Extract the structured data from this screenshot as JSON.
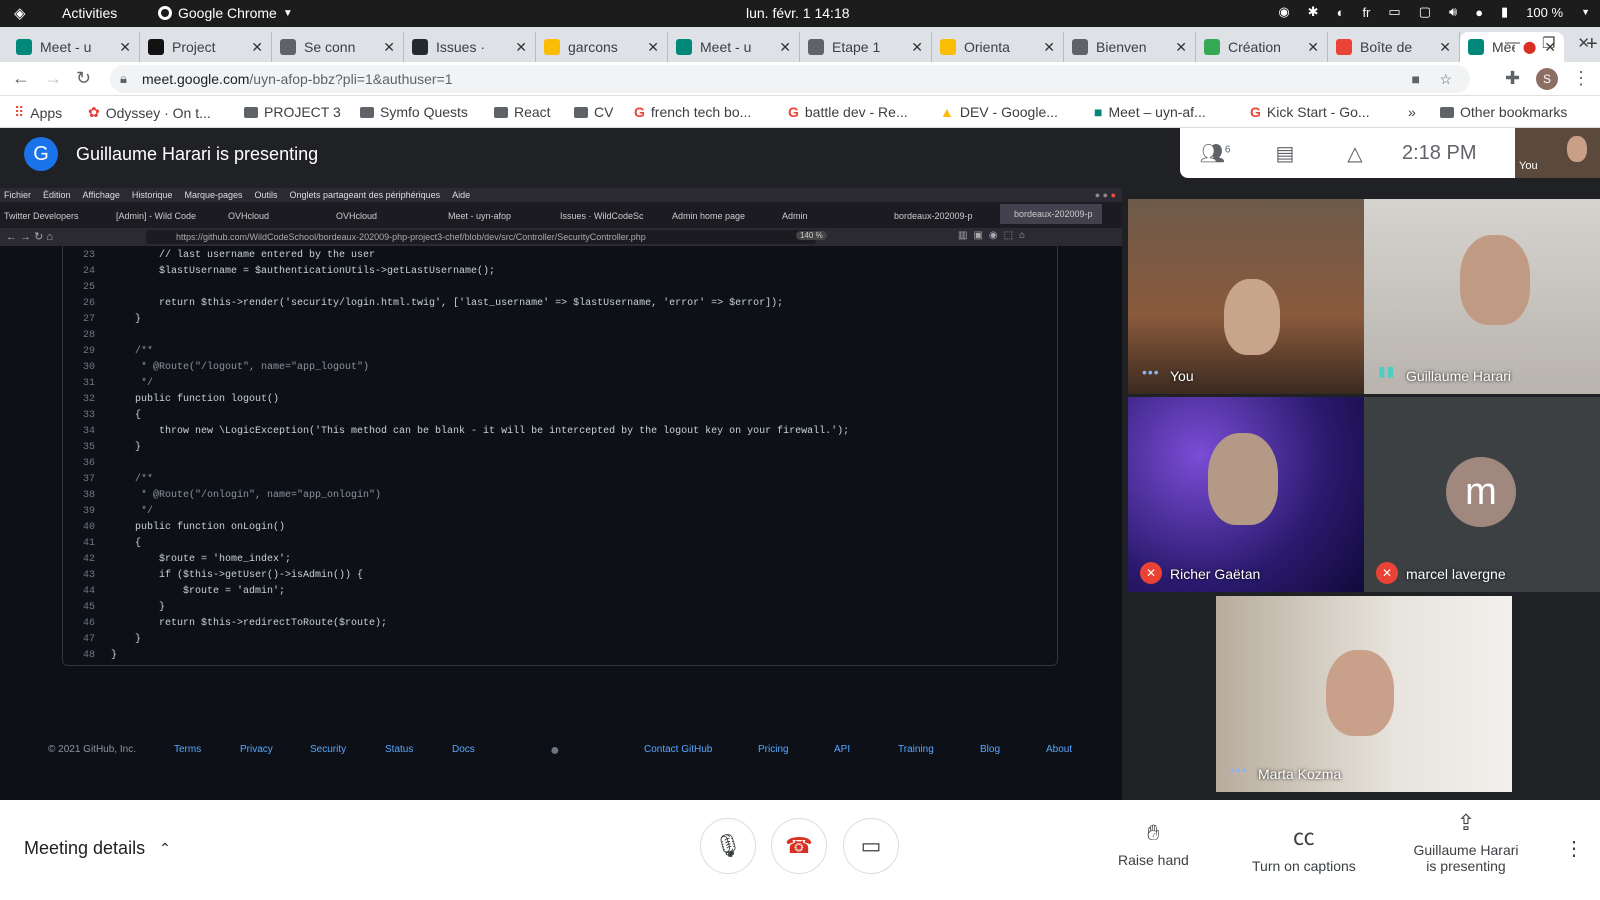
{
  "system_bar": {
    "activities": "Activities",
    "app_name": "Google Chrome",
    "clock": "lun. févr. 1  14:18",
    "lang": "fr",
    "battery": "100 %"
  },
  "browser_tabs": [
    {
      "title": "Meet - u",
      "color": "#00897b"
    },
    {
      "title": "Project",
      "color": "#111111"
    },
    {
      "title": "Se conn",
      "color": "#5f6368"
    },
    {
      "title": "Issues ·",
      "color": "#24292e"
    },
    {
      "title": "garcons",
      "color": "#fbbc04"
    },
    {
      "title": "Meet - u",
      "color": "#00897b"
    },
    {
      "title": "Etape 1",
      "color": "#5f6368"
    },
    {
      "title": "Orienta",
      "color": "#fbbc04"
    },
    {
      "title": "Bienven",
      "color": "#5f6368"
    },
    {
      "title": "Création",
      "color": "#34a853"
    },
    {
      "title": "Boîte de",
      "color": "#ea4335"
    },
    {
      "title": "Meet",
      "color": "#00897b"
    }
  ],
  "address": {
    "url_host": "meet.google.com",
    "url_path": "/uyn-afop-bbz?pli=1&authuser=1",
    "profile_initial": "S"
  },
  "bookmarks": {
    "items": [
      "Apps",
      "Odyssey · On t...",
      "PROJECT 3",
      "Symfo Quests",
      "React",
      "CV",
      "french tech bo...",
      "battle dev - Re...",
      "DEV - Google...",
      "Meet – uyn-af...",
      "Kick Start - Go..."
    ],
    "overflow": "»",
    "other": "Other bookmarks"
  },
  "meet": {
    "presenter_initial": "G",
    "presenting_text": "Guillaume Harari is presenting",
    "people_count": "6",
    "time": "2:18 PM",
    "you_label": "You"
  },
  "shared_screen": {
    "menu": [
      "Fichier",
      "Édition",
      "Affichage",
      "Historique",
      "Marque-pages",
      "Outils",
      "Onglets partageant des périphériques",
      "Aide"
    ],
    "tabs": [
      "Twitter Developers",
      "[Admin] - Wild Code",
      "OVHcloud",
      "OVHcloud",
      "Meet - uyn-afop",
      "Issues · WildCodeSc",
      "Admin home page",
      "Admin",
      "bordeaux-202009-p",
      "bordeaux-202009-p"
    ],
    "url": "https://github.com/WildCodeSchool/bordeaux-202009-php-project3-chef/blob/dev/src/Controller/SecurityController.php",
    "zoom": "140 %",
    "code_lines": [
      {
        "n": "23",
        "t": "        // last username entered by the user"
      },
      {
        "n": "24",
        "t": "        $lastUsername = $authenticationUtils->getLastUsername();"
      },
      {
        "n": "25",
        "t": ""
      },
      {
        "n": "26",
        "t": "        return $this->render('security/login.html.twig', ['last_username' => $lastUsername, 'error' => $error]);"
      },
      {
        "n": "27",
        "t": "    }"
      },
      {
        "n": "28",
        "t": ""
      },
      {
        "n": "29",
        "t": "    /**"
      },
      {
        "n": "30",
        "t": "     * @Route(\"/logout\", name=\"app_logout\")"
      },
      {
        "n": "31",
        "t": "     */"
      },
      {
        "n": "32",
        "t": "    public function logout()"
      },
      {
        "n": "33",
        "t": "    {"
      },
      {
        "n": "34",
        "t": "        throw new \\LogicException('This method can be blank - it will be intercepted by the logout key on your firewall.');"
      },
      {
        "n": "35",
        "t": "    }"
      },
      {
        "n": "36",
        "t": ""
      },
      {
        "n": "37",
        "t": "    /**"
      },
      {
        "n": "38",
        "t": "     * @Route(\"/onlogin\", name=\"app_onlogin\")"
      },
      {
        "n": "39",
        "t": "     */"
      },
      {
        "n": "40",
        "t": "    public function onLogin()"
      },
      {
        "n": "41",
        "t": "    {"
      },
      {
        "n": "42",
        "t": "        $route = 'home_index';"
      },
      {
        "n": "43",
        "t": "        if ($this->getUser()->isAdmin()) {"
      },
      {
        "n": "44",
        "t": "            $route = 'admin';"
      },
      {
        "n": "45",
        "t": "        }"
      },
      {
        "n": "46",
        "t": "        return $this->redirectToRoute($route);"
      },
      {
        "n": "47",
        "t": "    }"
      },
      {
        "n": "48",
        "t": "}"
      }
    ],
    "footer": {
      "copyright": "© 2021 GitHub, Inc.",
      "links": [
        "Terms",
        "Privacy",
        "Security",
        "Status",
        "Docs",
        "Contact GitHub",
        "Pricing",
        "API",
        "Training",
        "Blog",
        "About"
      ]
    }
  },
  "participants": [
    {
      "name": "You",
      "state": "dots"
    },
    {
      "name": "Guillaume Harari",
      "state": "speaking"
    },
    {
      "name": "Richer Gaëtan",
      "state": "muted"
    },
    {
      "name": "marcel lavergne",
      "state": "muted",
      "initial": "m",
      "avatar_color": "#a1887f"
    },
    {
      "name": "Marta Kozma",
      "state": "dots"
    }
  ],
  "bottom": {
    "meeting_details": "Meeting details",
    "raise_hand": "Raise hand",
    "captions": "Turn on captions",
    "presenting_line1": "Guillaume Harari",
    "presenting_line2": "is presenting"
  },
  "colors": {
    "accent": "#1a73e8",
    "end_call": "#d93025",
    "mute": "#ea4335"
  }
}
